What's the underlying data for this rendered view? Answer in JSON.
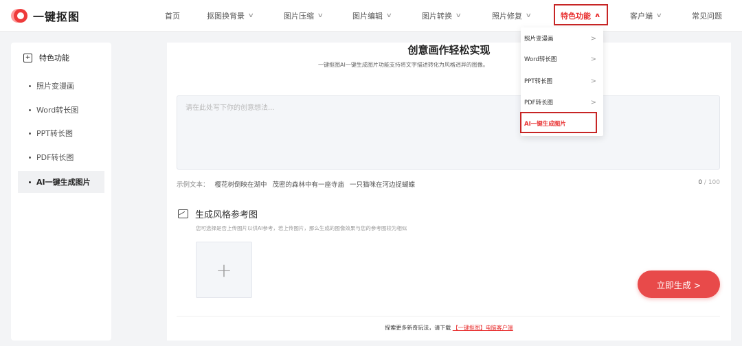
{
  "brand": {
    "name": "一键抠图"
  },
  "nav": {
    "items": [
      {
        "label": "首页",
        "has_menu": false
      },
      {
        "label": "抠图换背景",
        "has_menu": true
      },
      {
        "label": "图片压缩",
        "has_menu": true
      },
      {
        "label": "图片编辑",
        "has_menu": true
      },
      {
        "label": "图片转换",
        "has_menu": true
      },
      {
        "label": "照片修复",
        "has_menu": true
      },
      {
        "label": "特色功能",
        "has_menu": true,
        "active": true
      },
      {
        "label": "客户端",
        "has_menu": true
      },
      {
        "label": "常见问题",
        "has_menu": false
      }
    ],
    "active_color": "#e83131"
  },
  "sidebar": {
    "header": "特色功能",
    "items": [
      {
        "label": "照片变漫画"
      },
      {
        "label": "Word转长图"
      },
      {
        "label": "PPT转长图"
      },
      {
        "label": "PDF转长图"
      },
      {
        "label": "AI一键生成图片",
        "active": true
      }
    ]
  },
  "dropdown": {
    "items": [
      {
        "label": "照片变漫画"
      },
      {
        "label": "Word转长图"
      },
      {
        "label": "PPT转长图"
      },
      {
        "label": "PDF转长图"
      },
      {
        "label": "AI一键生成图片",
        "active": true
      }
    ]
  },
  "main": {
    "title": "创意画作轻松实现",
    "subtitle": "一键抠图AI一键生成图片功能支持将文字描述转化为风格迥异的图像。",
    "prompt": {
      "placeholder": "请在此处写下你的创意想法...",
      "value": ""
    },
    "examples_label": "示例文本：",
    "examples": [
      "樱花树倒映在湖中",
      "茂密的森林中有一座寺庙",
      "一只猫咪在河边捉蝴蝶"
    ],
    "counter": {
      "current": "0",
      "max": "/ 100"
    },
    "style_section": {
      "title": "生成风格参考图",
      "description": "您可选择是否上传图片以供AI参考，若上传图片，那么生成的图像效果与您的参考图较为相似",
      "upload_symbol": "+"
    },
    "generate_button": "立即生成 >",
    "footer": {
      "text_before": "探索更多新奇玩法，请下载",
      "link": "【一键抠图】电脑客户端"
    }
  }
}
